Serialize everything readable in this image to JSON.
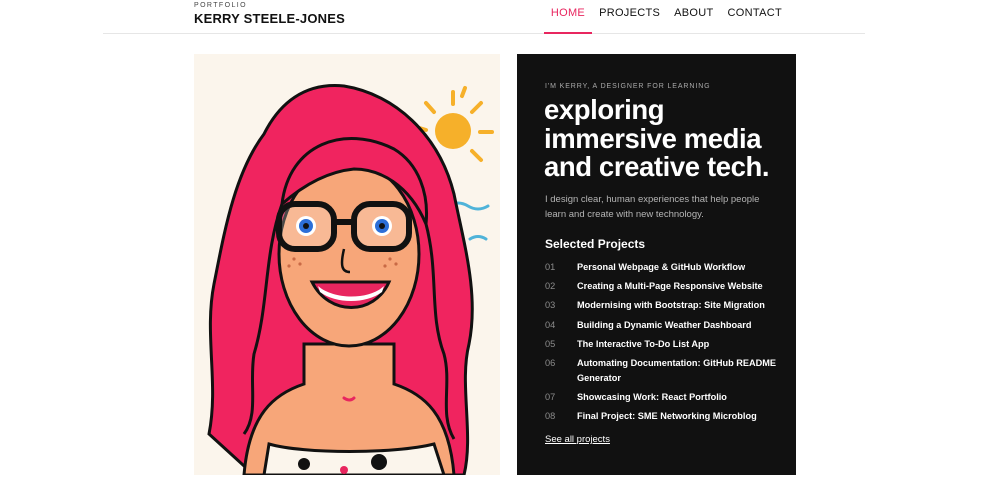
{
  "brand": {
    "kicker": "PORTFOLIO",
    "name": "KERRY STEELE-JONES"
  },
  "nav": {
    "items": [
      "HOME",
      "PROJECTS",
      "ABOUT",
      "CONTACT"
    ],
    "active": "HOME"
  },
  "colors": {
    "accent": "#e8265f",
    "panel": "#111111",
    "hair": "#f0245f",
    "sun": "#f6b02a"
  },
  "portrait": {
    "icon": "avatar-illustration"
  },
  "hero": {
    "kicker": "I'M KERRY, A DESIGNER FOR LEARNING",
    "headline": "exploring immersive media and creative tech.",
    "intro": "I design clear, human experiences that help people learn and create with new technology."
  },
  "projects": {
    "heading": "Selected Projects",
    "items": [
      {
        "num": "01",
        "title": "Personal Webpage & GitHub Workflow"
      },
      {
        "num": "02",
        "title": "Creating a Multi-Page Responsive Website"
      },
      {
        "num": "03",
        "title": "Modernising with Bootstrap: Site Migration"
      },
      {
        "num": "04",
        "title": "Building a Dynamic Weather Dashboard"
      },
      {
        "num": "05",
        "title": "The Interactive To-Do List App"
      },
      {
        "num": "06",
        "title": "Automating Documentation: GitHub README Generator"
      },
      {
        "num": "07",
        "title": "Showcasing Work: React Portfolio"
      },
      {
        "num": "08",
        "title": "Final Project: SME Networking Microblog"
      }
    ],
    "see_all": "See all projects"
  }
}
